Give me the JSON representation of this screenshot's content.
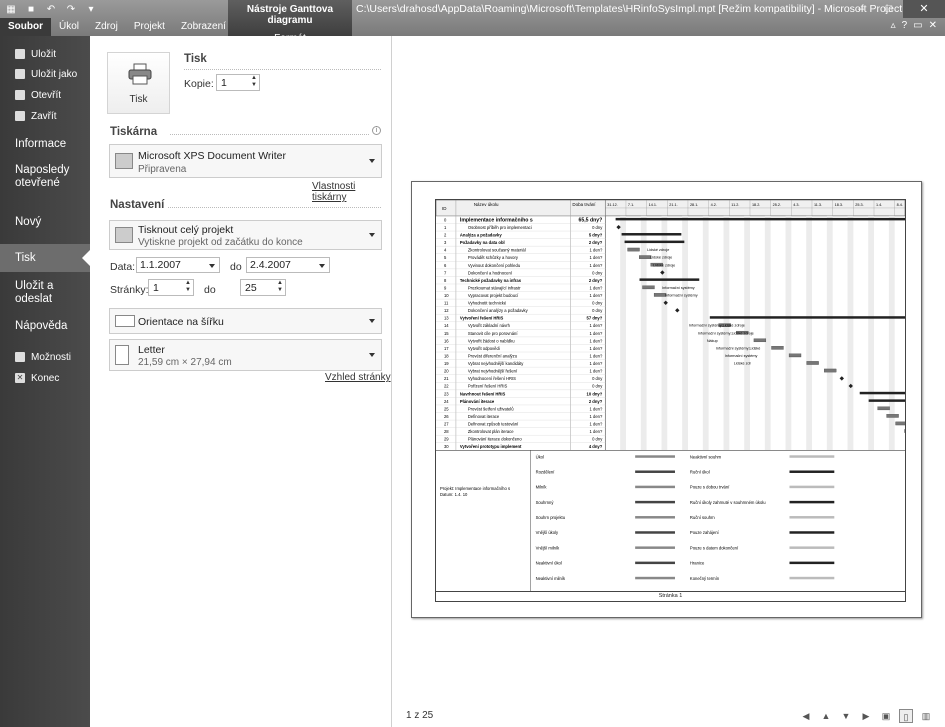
{
  "titlebar": {
    "context_title": "Nástroje Ganttova diagramu",
    "context_tab": "Formát",
    "window_title": "C:\\Users\\drahosd\\AppData\\Roaming\\Microsoft\\Templates\\HRinfoSysImpl.mpt [Režim kompatibility] - Microsoft Project",
    "minimize": "–",
    "maximize": "□",
    "close": "✕"
  },
  "ribbon_tabs": [
    "Soubor",
    "Úkol",
    "Zdroj",
    "Projekt",
    "Zobrazení"
  ],
  "nav": {
    "save": "Uložit",
    "save_as": "Uložit jako",
    "open": "Otevřít",
    "close": "Zavřít",
    "info": "Informace",
    "recent": "Naposledy otevřené",
    "new": "Nový",
    "print": "Tisk",
    "save_send": "Uložit a odeslat",
    "help": "Nápověda",
    "options": "Možnosti",
    "exit": "Konec"
  },
  "print": {
    "heading": "Tisk",
    "button_label": "Tisk",
    "copies_label": "Kopie:",
    "copies_value": "1"
  },
  "printer": {
    "heading": "Tiskárna",
    "name": "Microsoft XPS Document Writer",
    "status": "Připravena",
    "properties_link": "Vlastnosti tiskárny"
  },
  "settings": {
    "heading": "Nastavení",
    "scope_title": "Tisknout celý projekt",
    "scope_sub": "Vytiskne projekt od začátku do konce",
    "date_label": "Data:",
    "date_from": "1.1.2007",
    "date_to_label": "do",
    "date_to": "2.4.2007",
    "pages_label": "Stránky:",
    "pages_from": "1",
    "pages_to_label": "do",
    "pages_to": "25",
    "orientation": "Orientace na šířku",
    "paper_title": "Letter",
    "paper_sub": "21,59 cm × 27,94 cm",
    "page_setup_link": "Vzhled stránky"
  },
  "preview": {
    "pager": "1 z 25",
    "footer": "Stránka 1",
    "project_note": "Projekt: Implementace informačního s\nDatum: 1.4. 10",
    "timescale": [
      "31.12.",
      "7.1.",
      "14.1.",
      "21.1.",
      "28.1.",
      "4.2.",
      "11.2.",
      "18.2.",
      "25.2.",
      "4.3.",
      "11.3.",
      "18.3.",
      "25.3.",
      "1.4.",
      "8.4."
    ],
    "header": {
      "id": "ID",
      "name": "Název úkolu",
      "duration": "Doba trvání"
    },
    "rows": [
      {
        "id": "0",
        "name": "Implementace informačního s",
        "dur": "65,5 dny?",
        "summary": true
      },
      {
        "id": "1",
        "name": "Osobnost příběh pro implementaci",
        "dur": "0 dny"
      },
      {
        "id": "2",
        "name": "Analýza a požadavky",
        "dur": "5 dny?",
        "summary": true
      },
      {
        "id": "3",
        "name": "Požadavky na data obl",
        "dur": "2 dny?",
        "summary": true
      },
      {
        "id": "4",
        "name": "Zkontrolovat současný materiál",
        "dur": "1 den?"
      },
      {
        "id": "5",
        "name": "Provádět schůzky a hovory",
        "dur": "1 den?"
      },
      {
        "id": "6",
        "name": "Vyvinout dokončení pohledu",
        "dur": "1 den?"
      },
      {
        "id": "7",
        "name": "Dokončení a hodnocení",
        "dur": "0 dny"
      },
      {
        "id": "8",
        "name": "Technické požadavky na infras",
        "dur": "2 dny?",
        "summary": true
      },
      {
        "id": "9",
        "name": "Prozkoumat stávající infrastr",
        "dur": "1 den?"
      },
      {
        "id": "10",
        "name": "Vypracovat projekt budoucí",
        "dur": "1 den?"
      },
      {
        "id": "11",
        "name": "Vyhodnotit technické",
        "dur": "0 dny"
      },
      {
        "id": "12",
        "name": "Dokončení analýzy a požadavky",
        "dur": "0 dny"
      },
      {
        "id": "13",
        "name": "Vytvoření řešení HRIS",
        "dur": "57 dny?",
        "summary": true
      },
      {
        "id": "14",
        "name": "Vytvořit základní návrh",
        "dur": "1 den?"
      },
      {
        "id": "15",
        "name": "Stanovit cíle pro porovnání",
        "dur": "1 den?"
      },
      {
        "id": "16",
        "name": "Vytvořit žádost o nabídku",
        "dur": "1 den?"
      },
      {
        "id": "17",
        "name": "Vytvořit odpovědi",
        "dur": "1 den?"
      },
      {
        "id": "18",
        "name": "Provést diferenční analýzu",
        "dur": "1 den?"
      },
      {
        "id": "19",
        "name": "Vybrat nejvhodnější kandidáty",
        "dur": "1 den?"
      },
      {
        "id": "20",
        "name": "Vybrat nejvhodnější řešení",
        "dur": "1 den?"
      },
      {
        "id": "21",
        "name": "Vyhodnocení řešení HRIS",
        "dur": "0 dny"
      },
      {
        "id": "22",
        "name": "Pořízení řešení HRIS",
        "dur": "0 dny"
      },
      {
        "id": "23",
        "name": "Navrhnout řešení HRIS",
        "dur": "10 dny?",
        "summary": true
      },
      {
        "id": "24",
        "name": "Plánování iterace",
        "dur": "2 dny?",
        "summary": true
      },
      {
        "id": "25",
        "name": "Provést šetření uživatelů",
        "dur": "1 den?"
      },
      {
        "id": "26",
        "name": "Definovat iterace",
        "dur": "1 den?"
      },
      {
        "id": "27",
        "name": "Definovat způsob testování",
        "dur": "1 den?"
      },
      {
        "id": "28",
        "name": "Zkontrolovat plán iterace",
        "dur": "1 den?"
      },
      {
        "id": "29",
        "name": "Plánování iterace dokončeno",
        "dur": "0 dny"
      },
      {
        "id": "30",
        "name": "Vytvoření prototypu implement",
        "dur": "4 dny?",
        "summary": true
      }
    ],
    "bar_labels": [
      {
        "row": 4,
        "text": "Lidské zdroje"
      },
      {
        "row": 5,
        "text": "Lidské zdroje"
      },
      {
        "row": 6,
        "text": "Lidské zdroje"
      },
      {
        "row": 9,
        "text": "Informační systémy"
      },
      {
        "row": 10,
        "text": "Informační systémy"
      },
      {
        "row": 14,
        "text": "Informační systémy;Lidské zdroje"
      },
      {
        "row": 15,
        "text": "Informační systémy;Lidské zdroje"
      },
      {
        "row": 16,
        "text": "Nákup"
      },
      {
        "row": 17,
        "text": "Informační systémy;Lidské"
      },
      {
        "row": 18,
        "text": "Informační systémy"
      },
      {
        "row": 19,
        "text": "Lidské zdr"
      }
    ],
    "legend": [
      [
        "Úkol",
        "Neaktivní souhrn"
      ],
      [
        "Rozdělení",
        "Ruční úkol"
      ],
      [
        "Milník",
        "Pouze s dobou trvání"
      ],
      [
        "Souhrnný",
        "Ruční úkoly zahrnuté v souhrnném úkolu"
      ],
      [
        "Souhrn projektu",
        "Ruční souhrn"
      ],
      [
        "Vnější úkoly",
        "Pouze zahájení"
      ],
      [
        "Vnější milník",
        "Pouze s datem dokončení"
      ],
      [
        "Neaktivní úkol",
        "Hranice"
      ],
      [
        "Neaktivní milník",
        "Konečný termín"
      ]
    ]
  }
}
